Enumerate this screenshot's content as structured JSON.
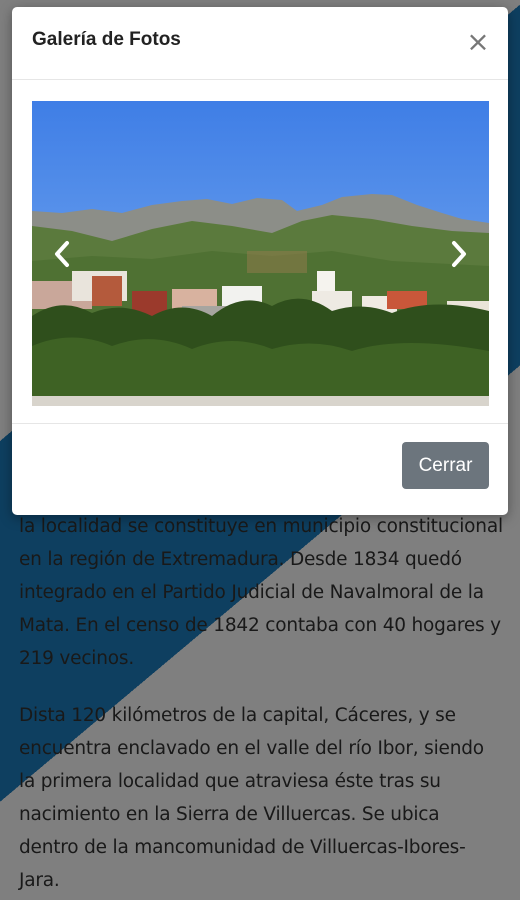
{
  "modal": {
    "title": "Galería de Fotos",
    "close_symbol": "×",
    "prev_icon": "chevron-left-icon",
    "next_icon": "chevron-right-icon",
    "footer_button": "Cerrar",
    "button_color": "#6c757d"
  },
  "page": {
    "paragraphs": [
      "la localidad se constituye en municipio constitucional en la región de Extremadura. Desde 1834 quedó integrado en el Partido Judicial de Navalmoral de la Mata. En el censo de 1842 contaba con 40 hogares y 219 vecinos.",
      "Dista 120 kilómetros de la capital, Cáceres, y se encuentra enclavado en el valle del río Ibor, siendo la primera localidad que atraviesa éste tras su nacimiento en la Sierra de Villuercas. Se ubica dentro de la mancomunidad de Villuercas-Ibores-Jara."
    ],
    "accent_color": "#1d7fc0"
  }
}
